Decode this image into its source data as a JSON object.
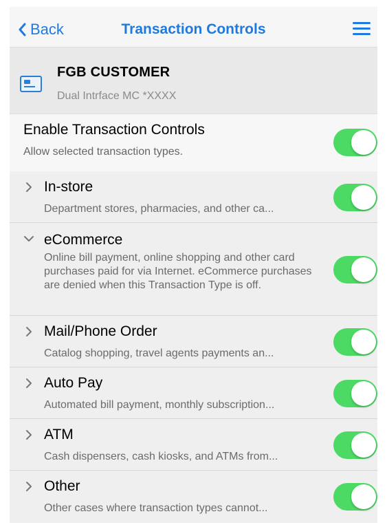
{
  "nav": {
    "back_label": "Back",
    "title": "Transaction Controls"
  },
  "card": {
    "name": "FGB CUSTOMER",
    "account": "Dual Intrface MC *XXXX",
    "icon": "credit-card-icon"
  },
  "enable": {
    "title": "Enable Transaction Controls",
    "subtitle": "Allow selected transaction types.",
    "on": true
  },
  "transaction_types": [
    {
      "title": "In-store",
      "description": "Department stores, pharmacies, and other ca...",
      "expanded": false,
      "on": true
    },
    {
      "title": "eCommerce",
      "description": "Online bill payment, online shopping and other card purchases paid for via Internet. eCommerce purchases are denied when this Transaction Type is off.",
      "expanded": true,
      "on": true
    },
    {
      "title": "Mail/Phone Order",
      "description": "Catalog shopping, travel agents payments an...",
      "expanded": false,
      "on": true
    },
    {
      "title": "Auto Pay",
      "description": "Automated bill payment, monthly subscription...",
      "expanded": false,
      "on": true
    },
    {
      "title": "ATM",
      "description": "Cash dispensers, cash kiosks, and ATMs from...",
      "expanded": false,
      "on": true
    },
    {
      "title": "Other",
      "description": "Other cases where transaction types cannot...",
      "expanded": false,
      "on": true
    }
  ],
  "colors": {
    "accent": "#1f7ae0",
    "toggle_on": "#4cd964"
  }
}
